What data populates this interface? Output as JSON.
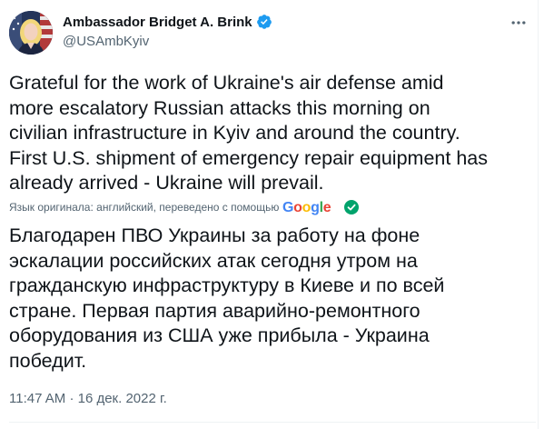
{
  "author": {
    "display_name": "Ambassador Bridget A. Brink",
    "handle": "@USAmbKyiv",
    "verified": true
  },
  "tweet": {
    "text": "Grateful for the work of Ukraine's air defense amid\nmore escalatory Russian attacks this morning on\ncivilian infrastructure in Kyiv and around the country.\nFirst U.S. shipment of emergency repair equipment has\nalready arrived - Ukraine will prevail.",
    "translation_note": "Язык оригинала: английский, переведено с помощью",
    "translation_provider": "Google",
    "translated_text": "Благодарен ПВО Украины за работу на фоне\nэскалации российских атак сегодня утром на\nгражданскую инфраструктуру в Киеве и по всей\nстране. Первая партия аварийно-ремонтного\nоборудования из США уже прибыла - Украина\nпобедит.",
    "time": "11:47 AM",
    "separator": "·",
    "date": "16 дек. 2022 г."
  },
  "colors": {
    "verified_blue": "#1d9bf0",
    "secondary_text": "#536471",
    "translation_check_green": "#00a36c",
    "google_blue": "#4285f4",
    "google_red": "#ea4335",
    "google_yellow": "#fbbc05",
    "google_green": "#34a853"
  },
  "icons": {
    "verified": "verified-badge-icon",
    "more": "more-options-icon",
    "translation_check": "check-circle-icon"
  }
}
